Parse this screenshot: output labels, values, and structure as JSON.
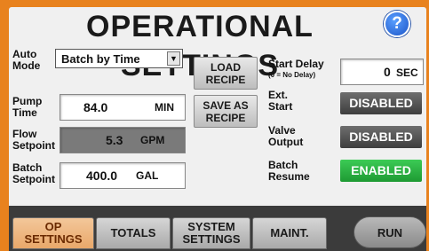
{
  "header": {
    "title": "OPERATIONAL SETTINGS",
    "help_glyph": "?"
  },
  "left": {
    "auto_mode": {
      "label_l1": "Auto",
      "label_l2": "Mode",
      "selected": "Batch by Time"
    },
    "pump_time": {
      "label_l1": "Pump",
      "label_l2": "Time",
      "value": "84.0",
      "unit": "MIN"
    },
    "flow_setpoint": {
      "label_l1": "Flow",
      "label_l2": "Setpoint",
      "value": "5.3",
      "unit": "GPM"
    },
    "batch_setpoint": {
      "label_l1": "Batch",
      "label_l2": "Setpoint",
      "value": "400.0",
      "unit": "GAL"
    }
  },
  "buttons": {
    "load_recipe": {
      "l1": "LOAD",
      "l2": "RECIPE"
    },
    "save_recipe": {
      "l1": "SAVE AS",
      "l2": "RECIPE"
    }
  },
  "right": {
    "start_delay": {
      "label": "Start Delay",
      "sub": "(0 = No Delay)",
      "value": "0",
      "unit": "SEC"
    },
    "ext_start": {
      "label_l1": "Ext.",
      "label_l2": "Start",
      "state": "DISABLED"
    },
    "valve_output": {
      "label_l1": "Valve",
      "label_l2": "Output",
      "state": "DISABLED"
    },
    "batch_resume": {
      "label_l1": "Batch",
      "label_l2": "Resume",
      "state": "ENABLED"
    }
  },
  "tabs": [
    {
      "l1": "OP",
      "l2": "SETTINGS"
    },
    {
      "l1": "TOTALS",
      "l2": ""
    },
    {
      "l1": "SYSTEM",
      "l2": "SETTINGS"
    },
    {
      "l1": "MAINT.",
      "l2": ""
    }
  ],
  "run_label": "RUN",
  "colors": {
    "background": "#e8821e",
    "enabled": "#2db844",
    "disabled": "#555555",
    "active_tab": "#f0b47c"
  }
}
